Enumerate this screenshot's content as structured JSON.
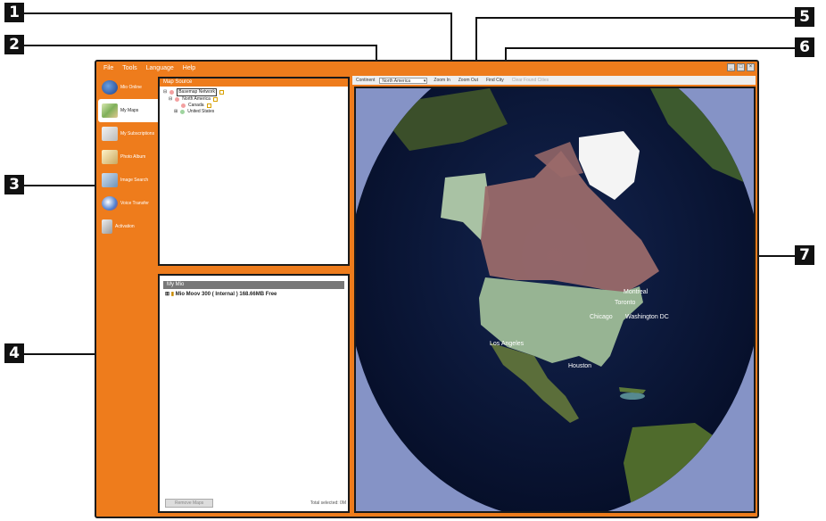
{
  "callouts": [
    "1",
    "2",
    "3",
    "4",
    "5",
    "6",
    "7"
  ],
  "menu": [
    "File",
    "Tools",
    "Language",
    "Help"
  ],
  "nav": [
    {
      "label": "Mio Online",
      "icon": "globe-icon"
    },
    {
      "label": "My Maps",
      "icon": "maps-icon"
    },
    {
      "label": "My Subscriptions",
      "icon": "subscriptions-icon"
    },
    {
      "label": "Photo Album",
      "icon": "photo-album-icon"
    },
    {
      "label": "Image Search",
      "icon": "image-search-icon"
    },
    {
      "label": "Voice Transfer",
      "icon": "voice-icon"
    },
    {
      "label": "Activation",
      "icon": "activation-icon"
    }
  ],
  "map_source": {
    "title": "Map Source",
    "tree": [
      "Basemap Network",
      "North America",
      "Canada",
      "United States"
    ]
  },
  "my_mio": {
    "title": "My Mio",
    "device": "Mio Moov 300 ( Internal ) 168.66MB Free",
    "remove_button": "Remove Maps",
    "total_selected": "Total selected: 0M"
  },
  "toolbar": {
    "continent_label": "Continent",
    "continent_value": "North America",
    "zoom_in": "Zoom In",
    "zoom_out": "Zoom Out",
    "find_city": "Find City",
    "clear_found_cities": "Clear Found Cities"
  },
  "map_labels": [
    "Montreal",
    "Toronto",
    "Chicago",
    "Washington DC",
    "Houston",
    "Los Angeles"
  ],
  "colors": {
    "accent": "#ee7c1c",
    "ocean": "#0a1a3e",
    "canada": "#b07070",
    "usa": "#9fbf9a"
  }
}
